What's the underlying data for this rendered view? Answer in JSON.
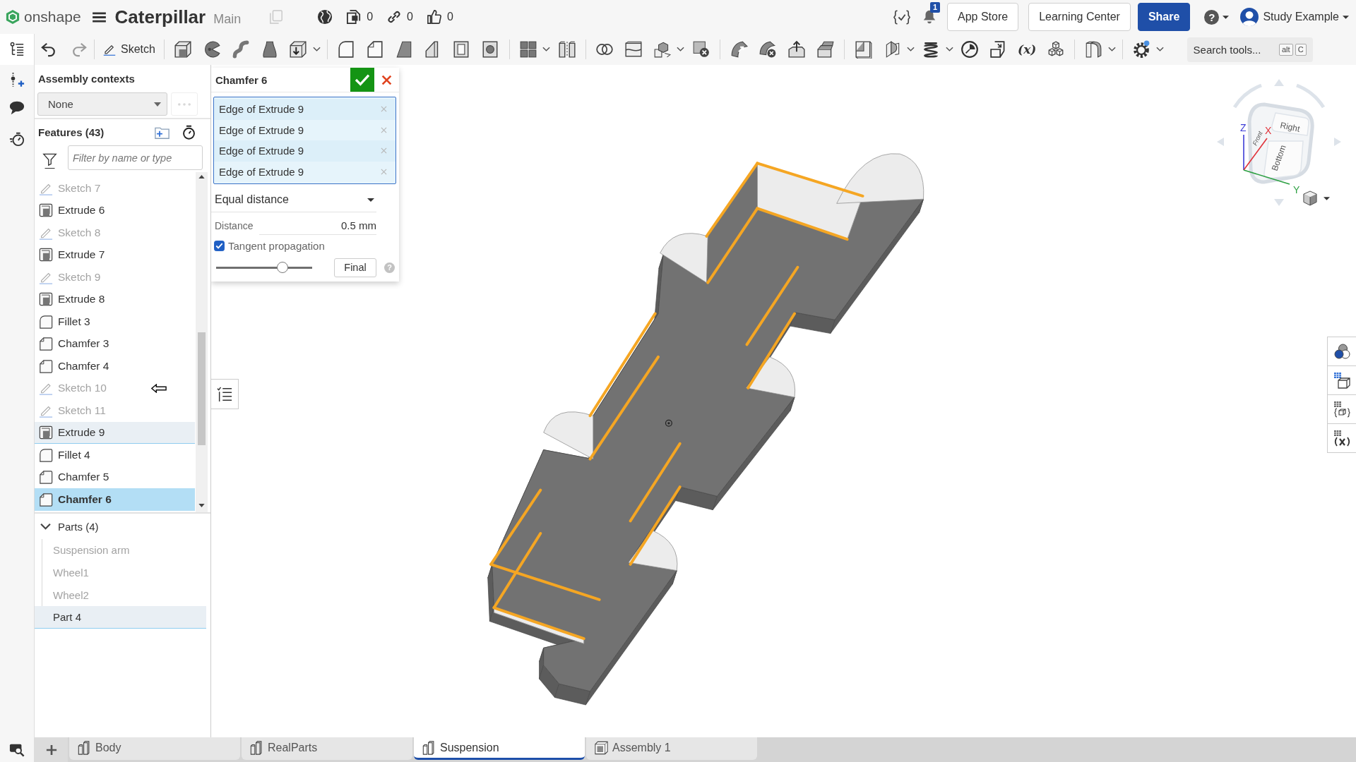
{
  "header": {
    "logo": "onshape",
    "document_title": "Caterpillar",
    "workspace": "Main",
    "counters": [
      {
        "kind": "versions",
        "count": "0"
      },
      {
        "kind": "links",
        "count": "0"
      },
      {
        "kind": "likes",
        "count": "0"
      }
    ],
    "notification_count": "1",
    "buttons": [
      {
        "label": "App Store",
        "kind": "plain"
      },
      {
        "label": "Learning Center",
        "kind": "plain"
      },
      {
        "label": "Share",
        "kind": "primary"
      }
    ],
    "help": "?",
    "user": "Study Example"
  },
  "toolbar": {
    "sketch": "Sketch",
    "variable_tool": "(x)",
    "search": {
      "placeholder": "Search tools...",
      "keys": [
        "alt",
        "C"
      ]
    }
  },
  "feature_panel": {
    "assembly_contexts": {
      "title": "Assembly contexts",
      "value": "None"
    },
    "features": {
      "title": "Features (43)",
      "filter": {
        "placeholder": "Filter by name or type"
      },
      "items": [
        {
          "name": "Sketch 7",
          "kind": "sketch",
          "hidden": true,
          "highlighted": false,
          "selected": false,
          "arrow": false
        },
        {
          "name": "Extrude 6",
          "kind": "extrude",
          "hidden": false,
          "highlighted": false,
          "selected": false,
          "arrow": false
        },
        {
          "name": "Sketch 8",
          "kind": "sketch",
          "hidden": true,
          "highlighted": false,
          "selected": false,
          "arrow": false
        },
        {
          "name": "Extrude 7",
          "kind": "extrude",
          "hidden": false,
          "highlighted": false,
          "selected": false,
          "arrow": false
        },
        {
          "name": "Sketch 9",
          "kind": "sketch",
          "hidden": true,
          "highlighted": false,
          "selected": false,
          "arrow": false
        },
        {
          "name": "Extrude 8",
          "kind": "extrude",
          "hidden": false,
          "highlighted": false,
          "selected": false,
          "arrow": false
        },
        {
          "name": "Fillet 3",
          "kind": "fillet",
          "hidden": false,
          "highlighted": false,
          "selected": false,
          "arrow": false
        },
        {
          "name": "Chamfer 3",
          "kind": "chamfer",
          "hidden": false,
          "highlighted": false,
          "selected": false,
          "arrow": false
        },
        {
          "name": "Chamfer 4",
          "kind": "chamfer",
          "hidden": false,
          "highlighted": false,
          "selected": false,
          "arrow": false
        },
        {
          "name": "Sketch 10",
          "kind": "sketch",
          "hidden": true,
          "highlighted": false,
          "selected": false,
          "arrow": true
        },
        {
          "name": "Sketch 11",
          "kind": "sketch",
          "hidden": true,
          "highlighted": false,
          "selected": false,
          "arrow": false
        },
        {
          "name": "Extrude 9",
          "kind": "extrude",
          "hidden": false,
          "highlighted": true,
          "selected": false,
          "arrow": false
        },
        {
          "name": "Fillet 4",
          "kind": "fillet",
          "hidden": false,
          "highlighted": false,
          "selected": false,
          "arrow": false
        },
        {
          "name": "Chamfer 5",
          "kind": "chamfer",
          "hidden": false,
          "highlighted": false,
          "selected": false,
          "arrow": false
        },
        {
          "name": "Chamfer 6",
          "kind": "chamfer",
          "hidden": false,
          "highlighted": false,
          "selected": true,
          "arrow": false
        }
      ]
    },
    "parts": {
      "title": "Parts (4)",
      "expanded": true,
      "items": [
        {
          "name": "Suspension arm",
          "hidden": true,
          "highlighted": false
        },
        {
          "name": "Wheel1",
          "hidden": true,
          "highlighted": false
        },
        {
          "name": "Wheel2",
          "hidden": true,
          "highlighted": false
        },
        {
          "name": "Part 4",
          "hidden": false,
          "highlighted": true
        }
      ]
    }
  },
  "chamfer_dialog": {
    "title": "Chamfer 6",
    "selections": [
      "Edge of Extrude 9",
      "Edge of Extrude 9",
      "Edge of Extrude 9",
      "Edge of Extrude 9"
    ],
    "type": "Equal distance",
    "distance": {
      "label": "Distance",
      "value": "0.5 mm"
    },
    "tangent_propagation": {
      "label": "Tangent propagation",
      "checked": true
    },
    "slider": {
      "level": 0.69
    },
    "final_button": "Final",
    "help": "?"
  },
  "view_cube": {
    "faces": [
      "Right",
      "Front",
      "Bottom"
    ],
    "axes": [
      {
        "label": "Z",
        "color": "#3b3bd6"
      },
      {
        "label": "X",
        "color": "#e0323a"
      },
      {
        "label": "Y",
        "color": "#2ea043"
      }
    ]
  },
  "tabs": [
    {
      "label": "Body",
      "kind": "part_studio",
      "selected": false
    },
    {
      "label": "RealParts",
      "kind": "part_studio",
      "selected": false
    },
    {
      "label": "Suspension",
      "kind": "part_studio",
      "selected": true
    },
    {
      "label": "Assembly 1",
      "kind": "assembly",
      "selected": false
    }
  ]
}
